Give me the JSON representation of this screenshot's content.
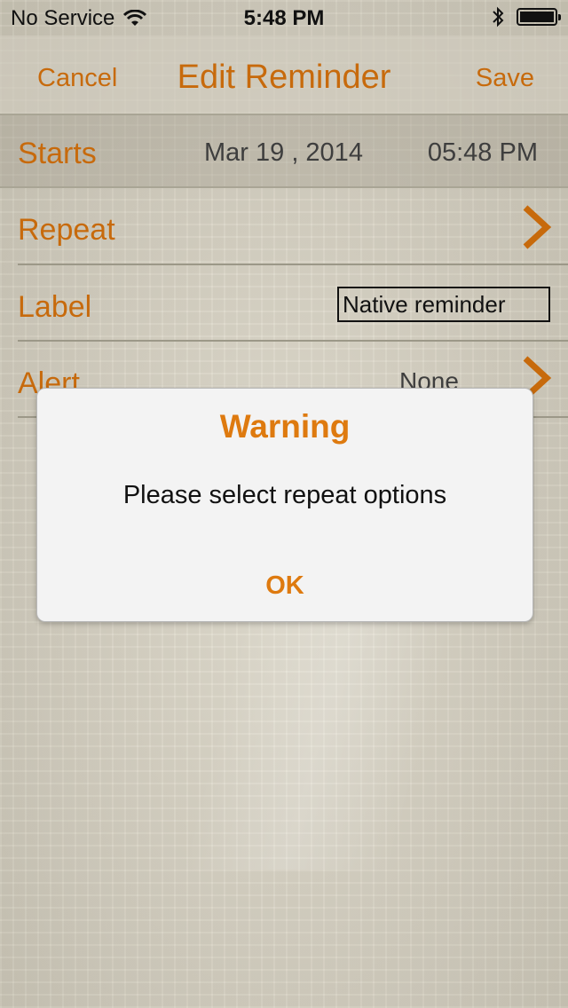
{
  "status_bar": {
    "carrier": "No Service",
    "time": "5:48 PM"
  },
  "nav": {
    "cancel_label": "Cancel",
    "title": "Edit Reminder",
    "save_label": "Save"
  },
  "form": {
    "starts": {
      "label": "Starts",
      "date": "Mar 19 , 2014",
      "time": "05:48 PM"
    },
    "repeat": {
      "label": "Repeat"
    },
    "label_field": {
      "label": "Label",
      "value": "Native reminder"
    },
    "alert": {
      "label": "Alert",
      "value": "None"
    }
  },
  "dialog": {
    "title": "Warning",
    "message": "Please select repeat options",
    "ok_label": "OK"
  },
  "colors": {
    "accent": "#c76a0c",
    "dialog_accent": "#de7a0f"
  }
}
